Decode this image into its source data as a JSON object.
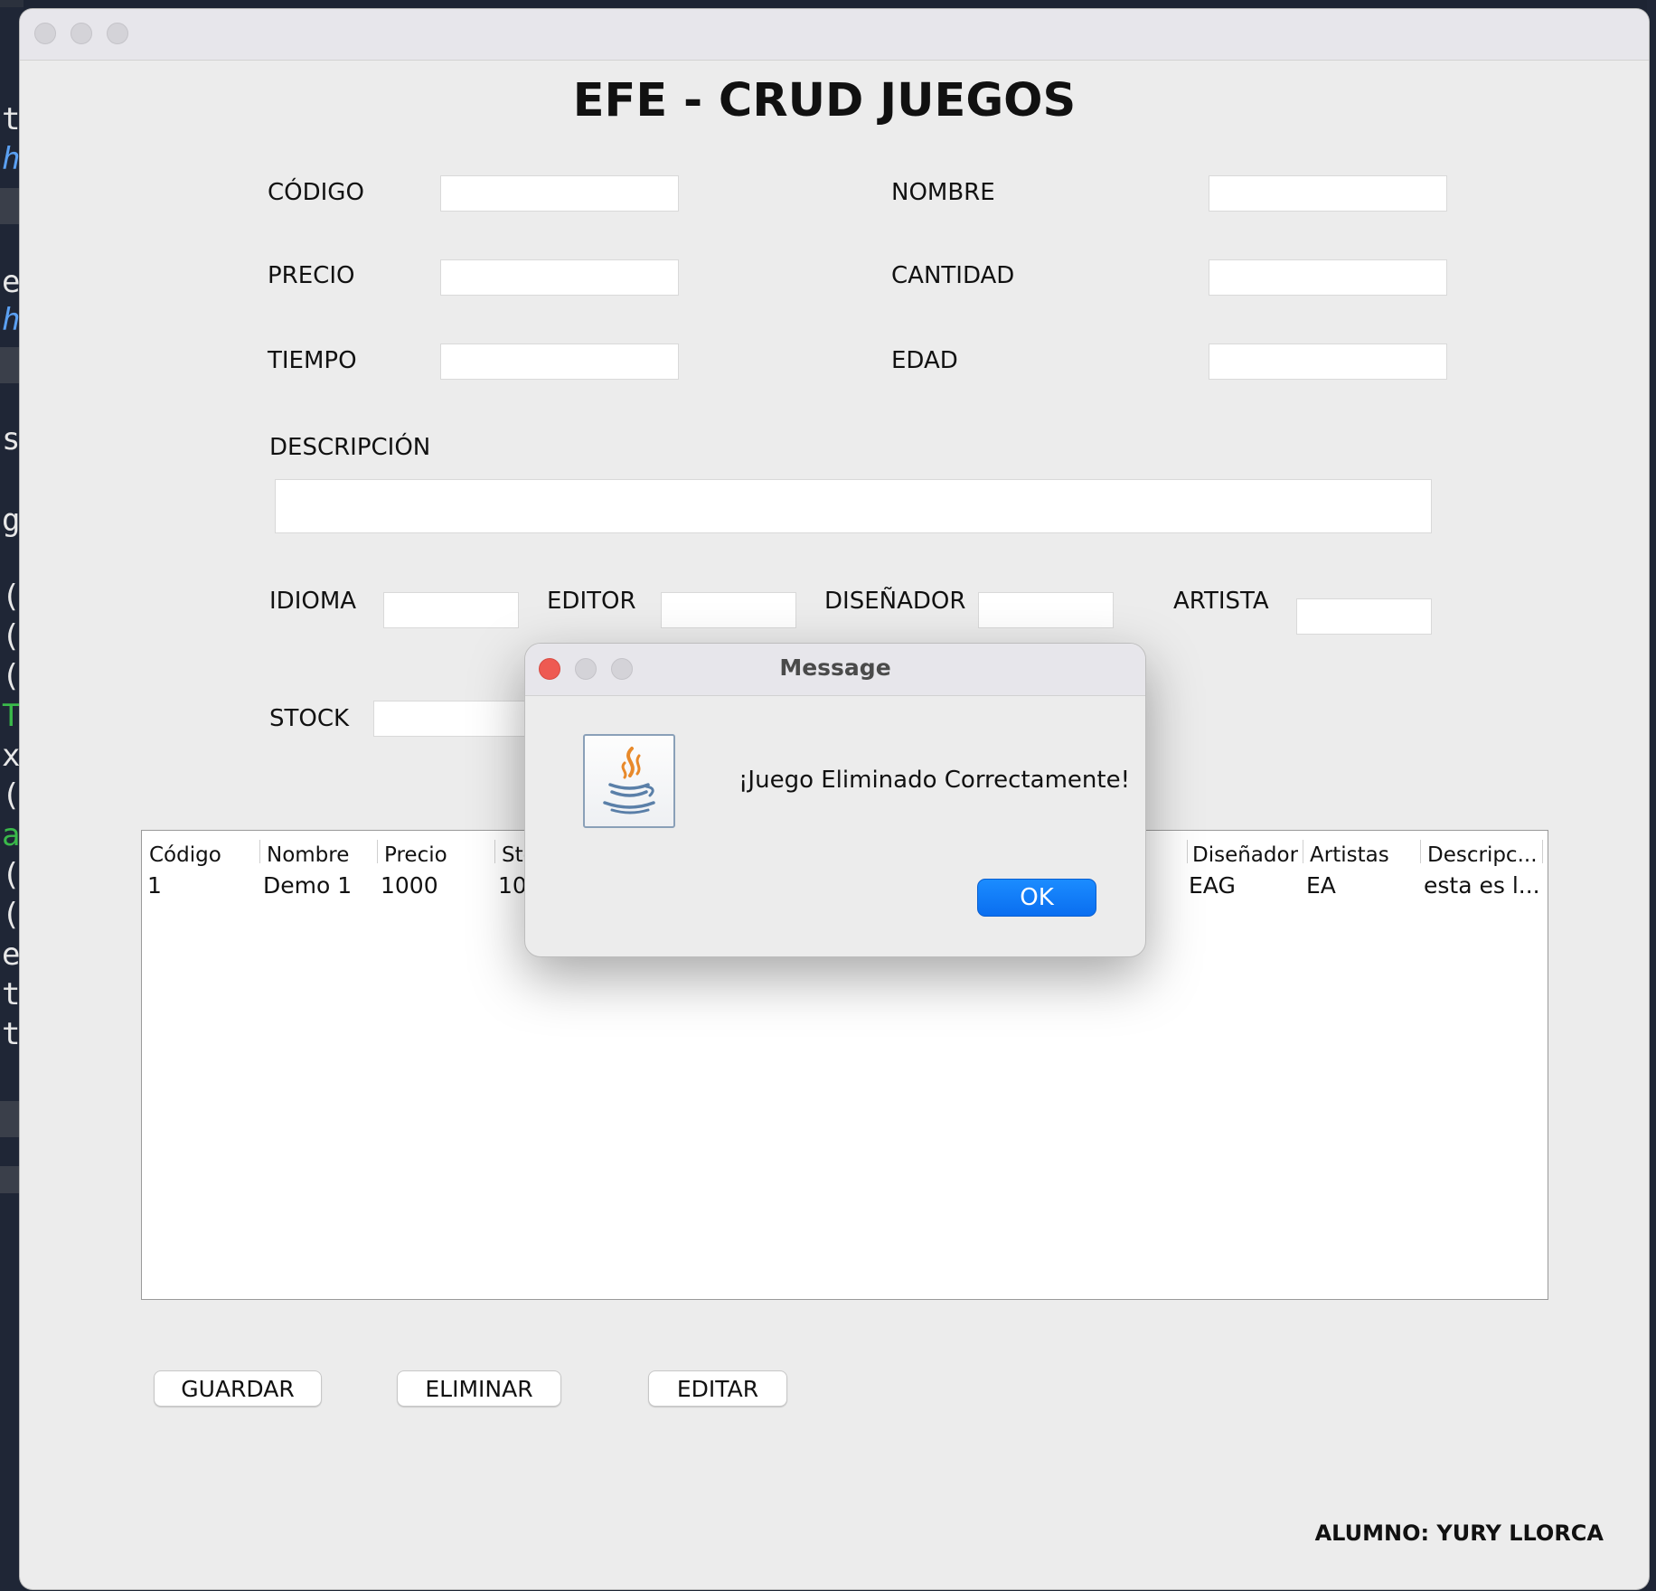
{
  "app": {
    "title": "EFE - CRUD JUEGOS",
    "student": "ALUMNO: YURY LLORCA"
  },
  "form": {
    "codigo": {
      "label": "CÓDIGO",
      "value": ""
    },
    "nombre": {
      "label": "NOMBRE",
      "value": ""
    },
    "precio": {
      "label": "PRECIO",
      "value": ""
    },
    "cantidad": {
      "label": "CANTIDAD",
      "value": ""
    },
    "tiempo": {
      "label": "TIEMPO",
      "value": ""
    },
    "edad": {
      "label": "EDAD",
      "value": ""
    },
    "descripcion": {
      "label": "DESCRIPCIÓN",
      "value": ""
    },
    "idioma": {
      "label": "IDIOMA",
      "value": ""
    },
    "editor": {
      "label": "EDITOR",
      "value": ""
    },
    "disenador": {
      "label": "DISEÑADOR",
      "value": ""
    },
    "artista": {
      "label": "ARTISTA",
      "value": ""
    },
    "stock": {
      "label": "STOCK",
      "value": ""
    }
  },
  "table": {
    "columns": [
      "Código",
      "Nombre",
      "Precio",
      "Sto",
      "Diseñador",
      "Artistas",
      "Descripc..."
    ],
    "rows": [
      [
        "1",
        "Demo 1",
        "1000",
        "10",
        "EAG",
        "EA",
        "esta es l..."
      ]
    ]
  },
  "buttons": {
    "guardar": "GUARDAR",
    "eliminar": "ELIMINAR",
    "editar": "EDITAR"
  },
  "dialog": {
    "title": "Message",
    "message": "¡Juego Eliminado Correctamente!",
    "ok": "OK",
    "icon": "java-icon"
  },
  "colors": {
    "window_bg": "#ececec",
    "ok_button": "#0a6ef0",
    "close_red": "#ee5a52"
  }
}
